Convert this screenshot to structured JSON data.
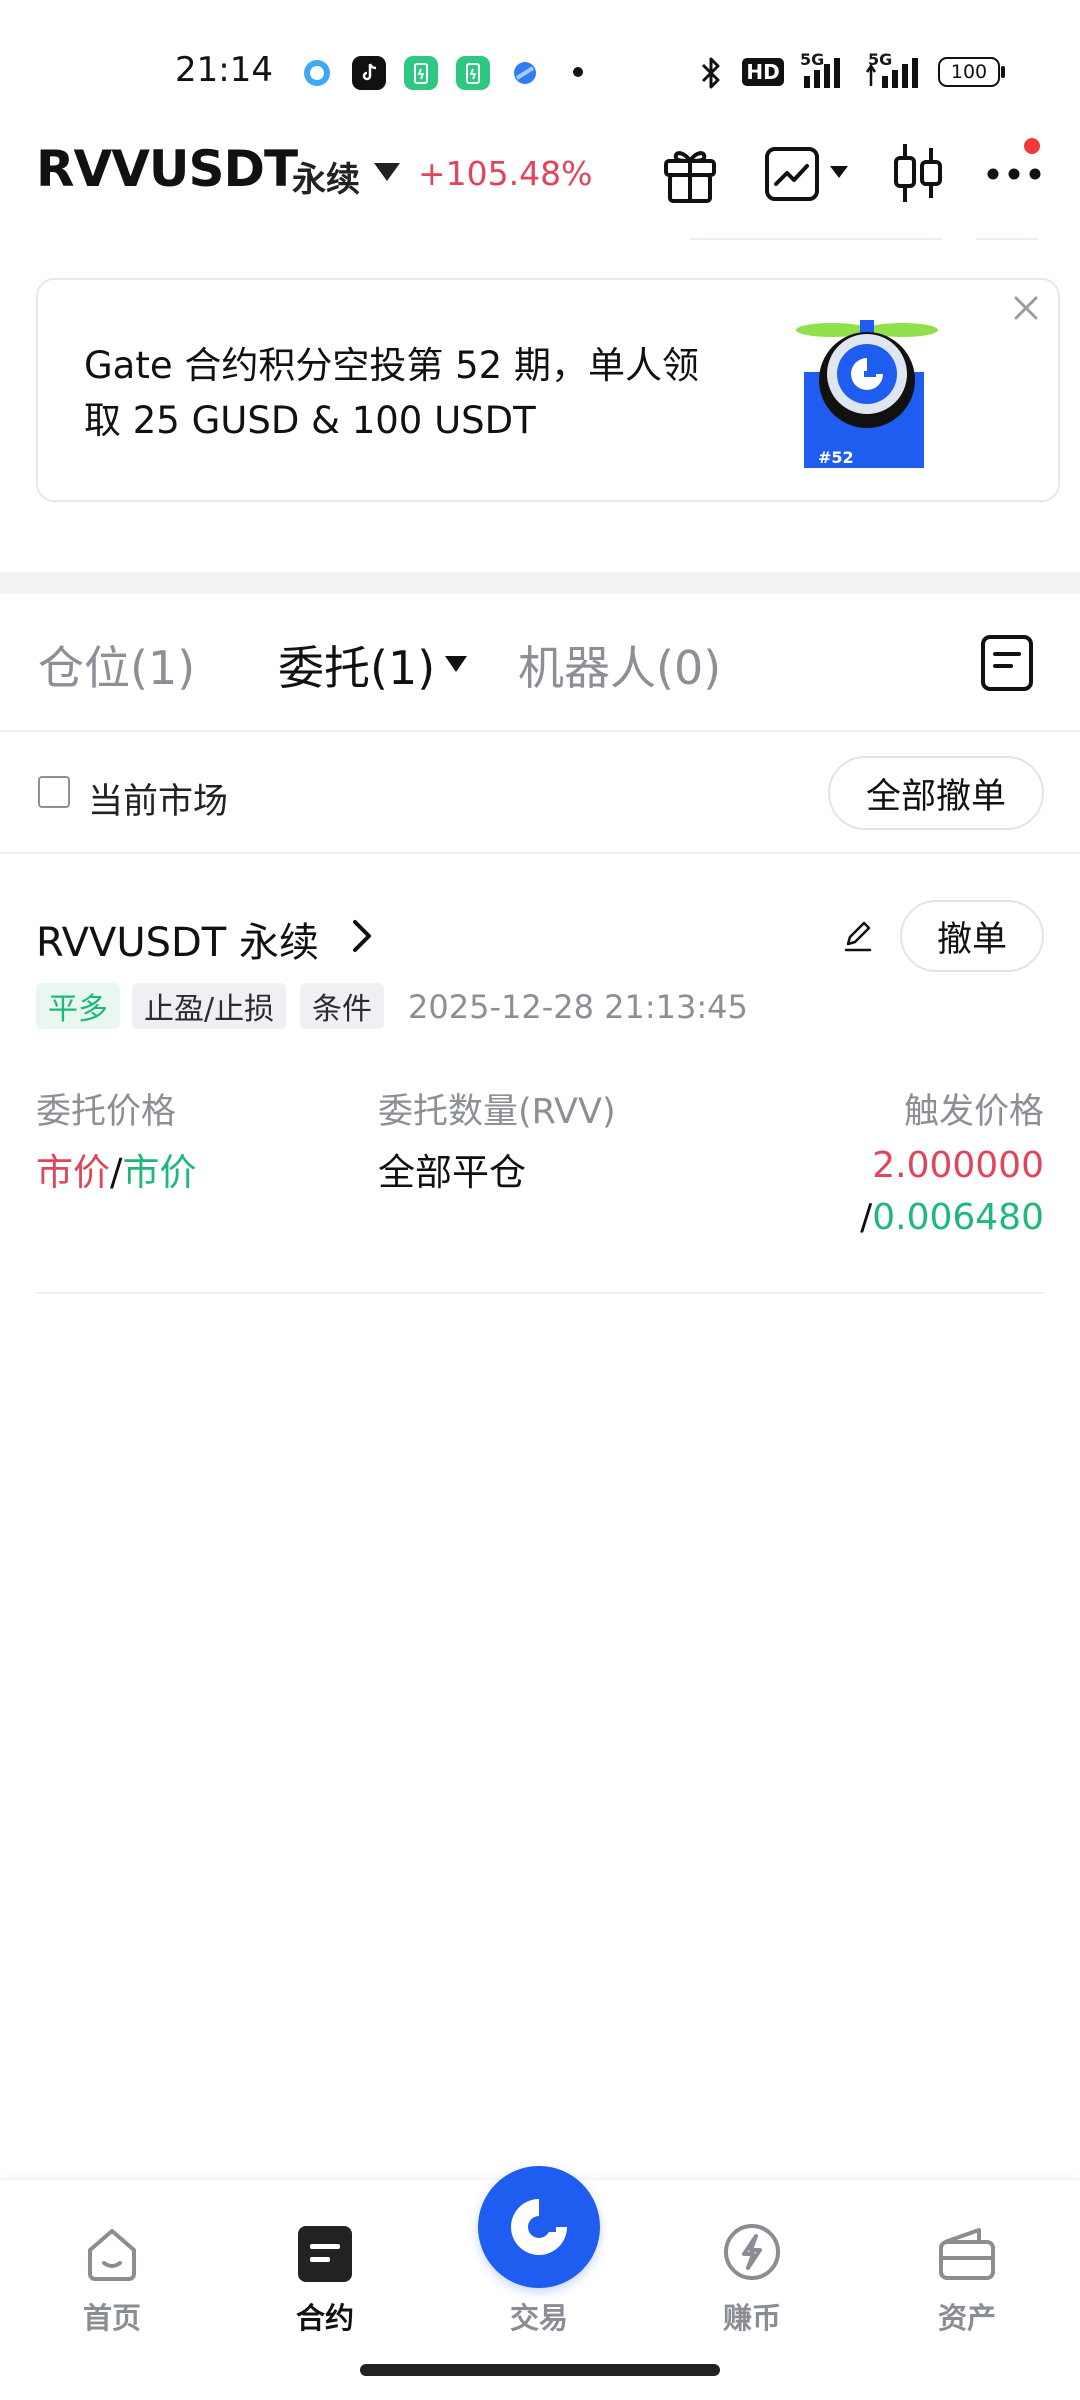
{
  "status_bar": {
    "time": "21:14",
    "network1": "5G",
    "network2": "5G",
    "hd_badge": "HD",
    "battery": "100",
    "icons": [
      "qq-browser-icon",
      "tiktok-icon",
      "battery-app-icon",
      "battery-app-icon",
      "app-icon",
      "dot-icon",
      "bluetooth-icon"
    ]
  },
  "header": {
    "symbol": "RVVUSDT",
    "contract_type": "永续",
    "change": "+105.48%",
    "icons": [
      "gift-icon",
      "chart-icon",
      "candlestick-icon",
      "more-icon"
    ]
  },
  "banner": {
    "text": "Gate 合约积分空投第 52 期，单人领取 25 GUSD & 100 USDT",
    "image_badge": "#52"
  },
  "tabs": [
    {
      "label": "仓位(1)",
      "active": false
    },
    {
      "label": "委托(1)",
      "active": true
    },
    {
      "label": "机器人(0)",
      "active": false
    }
  ],
  "filter": {
    "current_market_label": "当前市场",
    "current_market_checked": false,
    "cancel_all_label": "全部撤单"
  },
  "order": {
    "symbol": "RVVUSDT 永续",
    "cancel_label": "撤单",
    "tags": [
      "平多",
      "止盈/止损",
      "条件"
    ],
    "time": "2025-12-28 21:13:45",
    "columns": {
      "price_label": "委托价格",
      "qty_label": "委托数量(RVV)",
      "trigger_label": "触发价格"
    },
    "price_a": "市价",
    "price_sep": "/",
    "price_b": "市价",
    "qty": "全部平仓",
    "trigger_tp": "2.000000",
    "trigger_sep": "/",
    "trigger_sl": "0.006480"
  },
  "nav": {
    "items": [
      {
        "label": "首页",
        "icon": "home-icon",
        "active": false
      },
      {
        "label": "合约",
        "icon": "futures-icon",
        "active": true
      },
      {
        "label": "交易",
        "icon": "gate-logo-icon",
        "active": false
      },
      {
        "label": "赚币",
        "icon": "earn-icon",
        "active": false
      },
      {
        "label": "资产",
        "icon": "wallet-icon",
        "active": false
      }
    ]
  },
  "colors": {
    "up_red": "#e0455b",
    "down_green": "#1fb87a",
    "brand_blue": "#1f5cf0"
  }
}
